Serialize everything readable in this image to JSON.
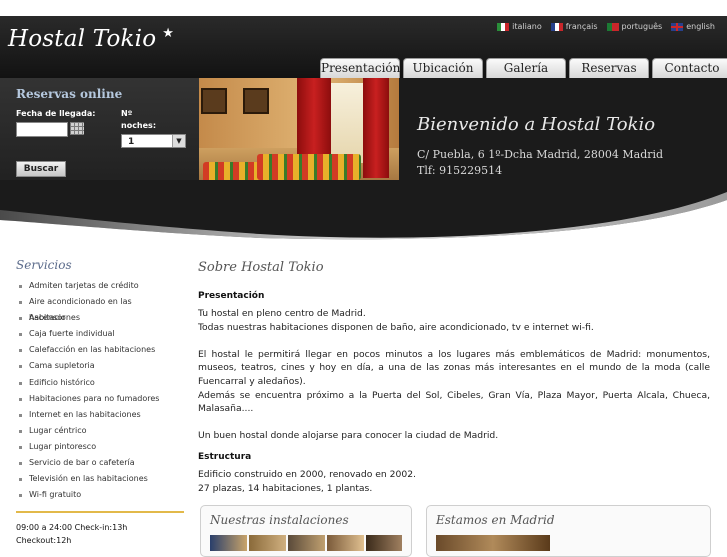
{
  "logo": {
    "text": "Hostal Tokio",
    "star": "★"
  },
  "languages": [
    {
      "label": "italiano",
      "icon": "flag-it"
    },
    {
      "label": "français",
      "icon": "flag-fr"
    },
    {
      "label": "português",
      "icon": "flag-pt"
    },
    {
      "label": "english",
      "icon": "flag-en"
    }
  ],
  "nav": {
    "tabs": [
      "Presentación",
      "Ubicación",
      "Galería",
      "Reservas",
      "Contacto"
    ]
  },
  "booking": {
    "title": "Reservas online",
    "date_label": "Fecha de llegada:",
    "nights_label_1": "Nº",
    "nights_label_2": "noches:",
    "nights_value": "1",
    "search_button": "Buscar"
  },
  "hero": {
    "headline": "Bienvenido a Hostal Tokio",
    "address": "C/ Puebla, 6 1º-Dcha Madrid, 28004 Madrid",
    "phone": "Tlf: 915229514"
  },
  "sidebar": {
    "title": "Servicios",
    "services": [
      "Admiten tarjetas de crédito",
      "Aire acondicionado en las habitaciones",
      "Ascensor",
      "Caja fuerte individual",
      "Calefacción en las habitaciones",
      "Cama supletoria",
      "Edificio histórico",
      "Habitaciones para no fumadores",
      "Internet en las habitaciones",
      "Lugar céntrico",
      "Lugar pintoresco",
      "Servicio de bar o cafetería",
      "Televisión en las habitaciones",
      "Wi-fi gratuito"
    ],
    "hours_line1": "09:00 a 24:00 Check-in:13h",
    "hours_line2": "Checkout:12h"
  },
  "main": {
    "title": "Sobre Hostal Tokio",
    "presentation_heading": "Presentación",
    "p1_line1": "Tu hostal en pleno centro de Madrid.",
    "p1_line2": "Todas nuestras habitaciones disponen de baño, aire acondicionado, tv e internet wi-fi.",
    "p2": "El hostal le permitirá llegar en pocos minutos a los lugares más emblemáticos de Madrid: monumentos, museos, teatros, cines y hoy en día, a una de las zonas más interesantes en el mundo de la moda (calle Fuencarral y aledaños).",
    "p3": "Además se encuentra próximo a la Puerta del Sol, Cibeles, Gran Vía, Plaza Mayor, Puerta Alcala, Chueca, Malasaña....",
    "p4": "Un buen hostal donde alojarse para conocer la ciudad de Madrid.",
    "structure_heading": "Estructura",
    "s_line1": "Edificio construido en 2000, renovado en 2002.",
    "s_line2": "27 plazas, 14 habitaciones, 1 plantas."
  },
  "boxes": {
    "gallery_title": "Nuestras instalaciones",
    "madrid_title": "Estamos en Madrid"
  },
  "colors": {
    "header_bg": "#1b1b1b",
    "booking_title": "#b5c8de",
    "sidebar_title": "#5a6a8a",
    "divider": "#e2b94a"
  }
}
